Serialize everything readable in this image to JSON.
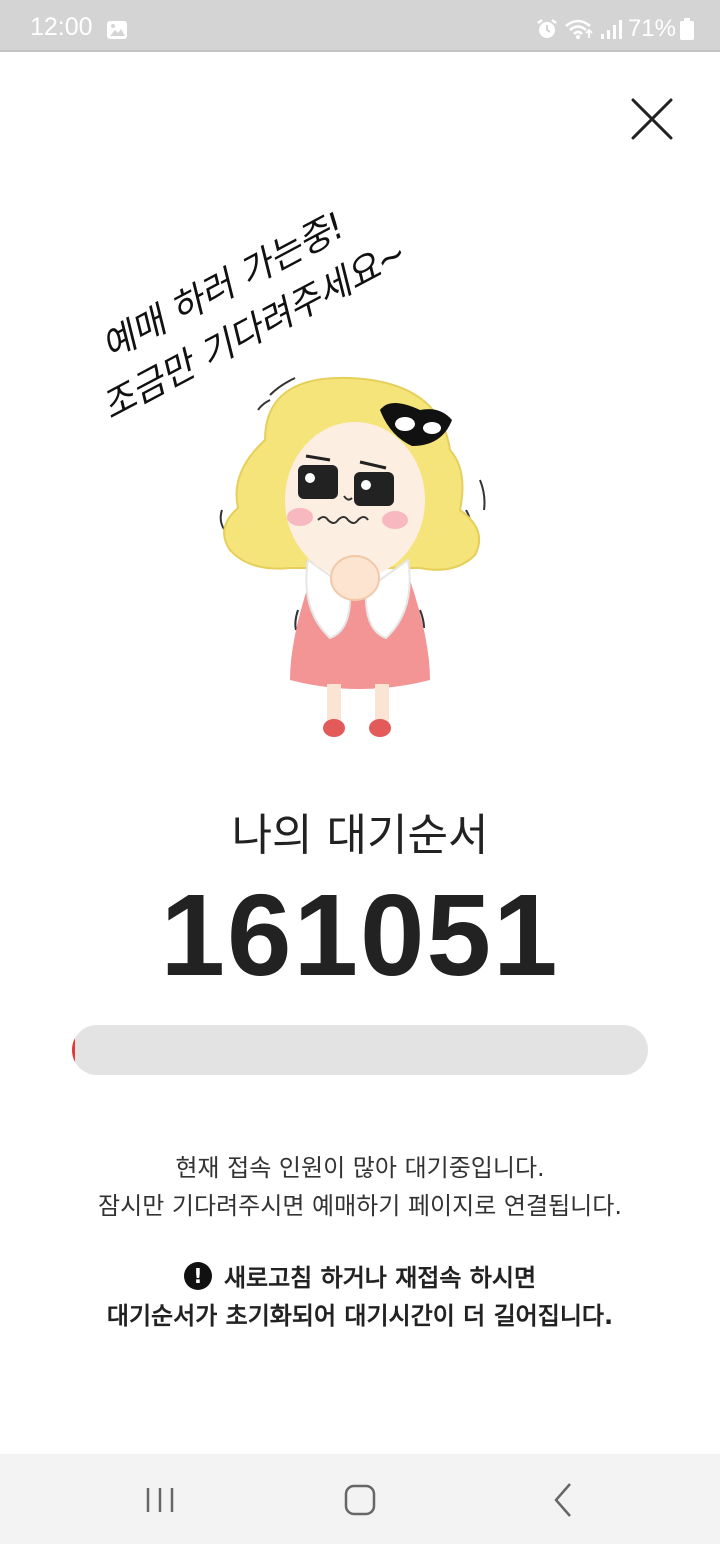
{
  "status_bar": {
    "time": "12:00",
    "battery_percent": "71%",
    "icons": [
      "gallery-icon",
      "alarm-icon",
      "wifi-icon",
      "signal-icon",
      "battery-icon"
    ]
  },
  "dialog": {
    "close_icon": "close-icon"
  },
  "queue": {
    "label": "나의 대기순서",
    "number": "161051",
    "progress_fraction": 0.005
  },
  "info": {
    "line1": "현재 접속 인원이 많아 대기중입니다.",
    "line2": "잠시만 기다려주시면 예매하기 페이지로 연결됩니다."
  },
  "warning": {
    "icon_text": "!",
    "line1": "새로고침 하거나 재접속 하시면",
    "line2": "대기순서가 초기화되어 대기시간이 더 길어집니다."
  },
  "illustration": {
    "handwriting_line1": "예매 하러 가는중!",
    "handwriting_line2": "조금만 기다려주세요~"
  },
  "colors": {
    "accent": "#e53935",
    "hair": "#f4e47a",
    "dress": "#f29594",
    "status_bar": "#d4d4d4"
  }
}
